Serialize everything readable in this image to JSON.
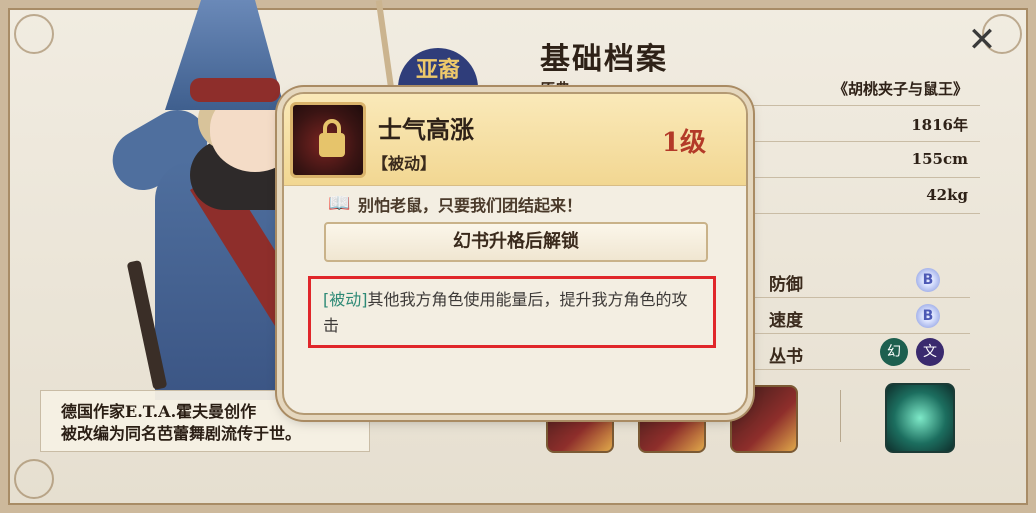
{
  "header": {
    "title": "基础档案",
    "close_icon": "close-x-icon"
  },
  "profile": {
    "rows": [
      {
        "label": "原典",
        "value": "《胡桃夹子与鼠王》"
      },
      {
        "label": "",
        "value": "1816年"
      },
      {
        "label": "",
        "value": "155cm"
      },
      {
        "label": "",
        "value": "42kg"
      }
    ]
  },
  "stats": {
    "rows": [
      {
        "label": "防御",
        "grade": "B"
      },
      {
        "label": "速度",
        "grade": "B"
      },
      {
        "label": "丛书",
        "icons": [
          "幻",
          "文"
        ]
      }
    ]
  },
  "description": {
    "line1": "德国作家E.T.A.霍夫曼创作",
    "line2": "被改编为同名芭蕾舞剧流传于世。"
  },
  "badge": {
    "text": "亚裔"
  },
  "popup": {
    "skill_name": "士气高涨",
    "skill_type": "【被动】",
    "skill_level": "1级",
    "quote": "别怕老鼠，只要我们团结起来！",
    "unlock_button": "幻书升格后解锁",
    "effect_tag": "[被动]",
    "effect_text": "其他我方角色使用能量后，提升我方角色的攻击"
  },
  "colors": {
    "level": "#b33a28",
    "effect_tag": "#2e8a76",
    "highlight_border": "#e0262a"
  }
}
